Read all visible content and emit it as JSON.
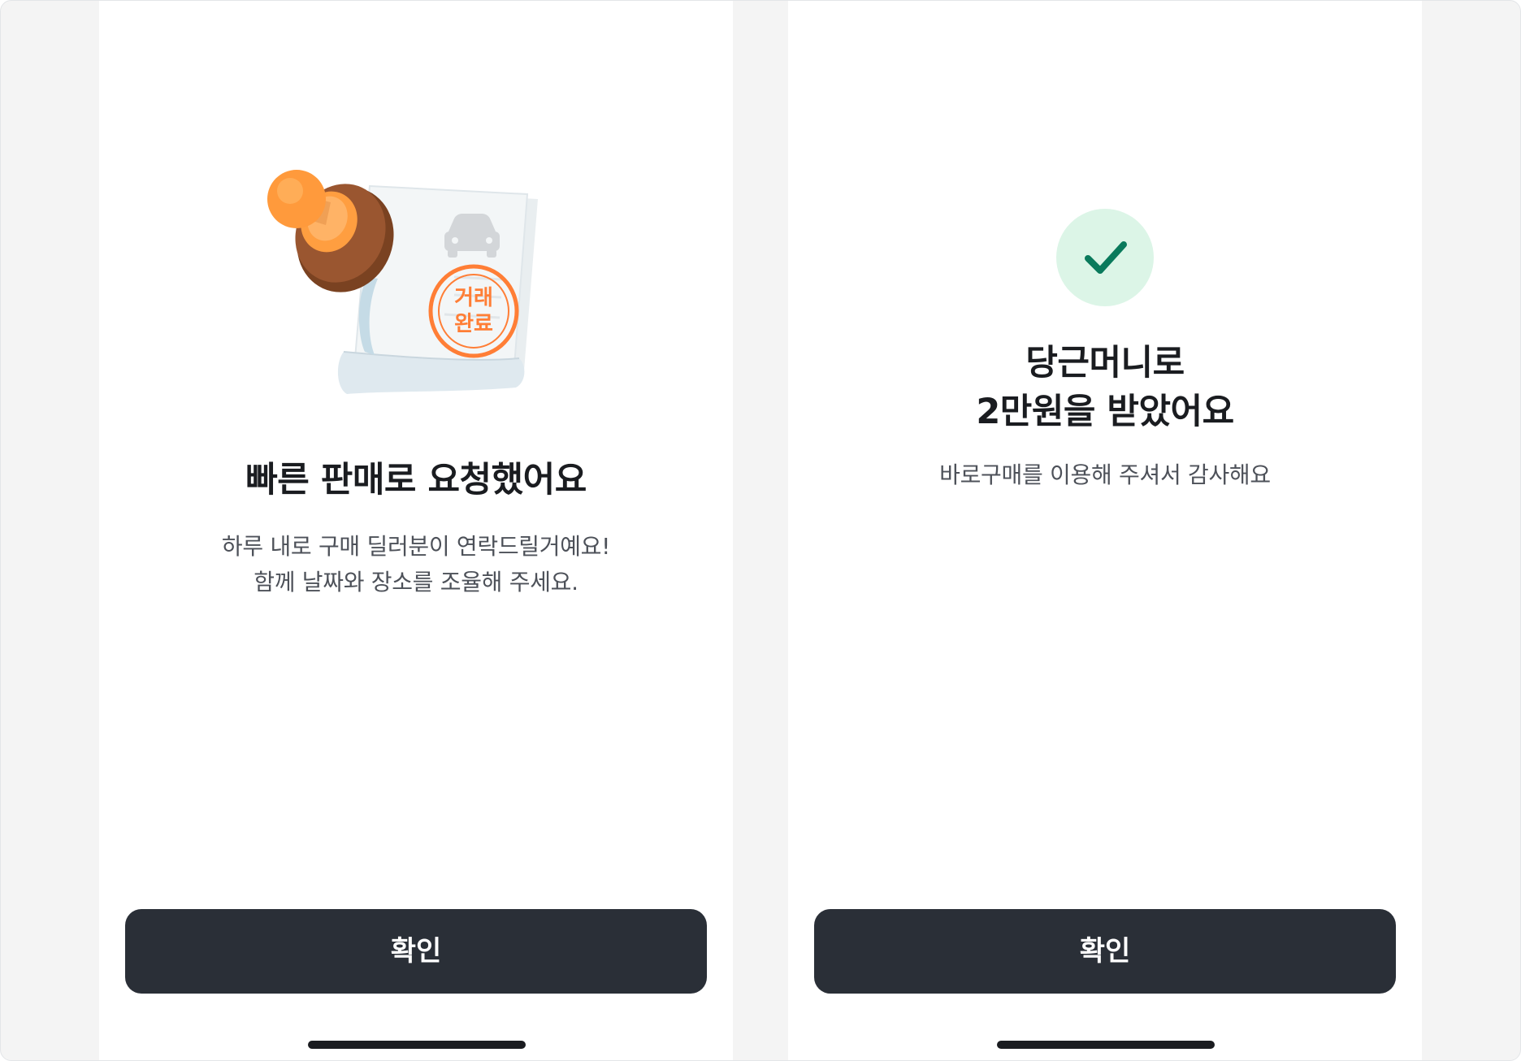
{
  "screens": [
    {
      "illustration": {
        "icon": "stamp-document-icon",
        "stamp_text": "거래\n완료",
        "stamp_color": "#ff7e36",
        "handle_color": "#ff9e40",
        "base_color": "#8b4a24"
      },
      "title": "빠른 판매로 요청했어요",
      "subtitle": "하루 내로 구매 딜러분이 연락드릴거예요!\n함께 날짜와 장소를 조율해 주세요.",
      "confirm_label": "확인"
    },
    {
      "badge": {
        "icon": "check-icon",
        "background": "#dcf5e7",
        "check_color": "#0a7a5c"
      },
      "title": "당근머니로\n2만원을 받았어요",
      "subtitle": "바로구매를 이용해 주셔서 감사해요",
      "confirm_label": "확인"
    }
  ],
  "colors": {
    "button": "#2a2f37",
    "outer_background": "#f4f4f4",
    "title_text": "#1a1c20",
    "subtitle_text": "#4d5159"
  }
}
